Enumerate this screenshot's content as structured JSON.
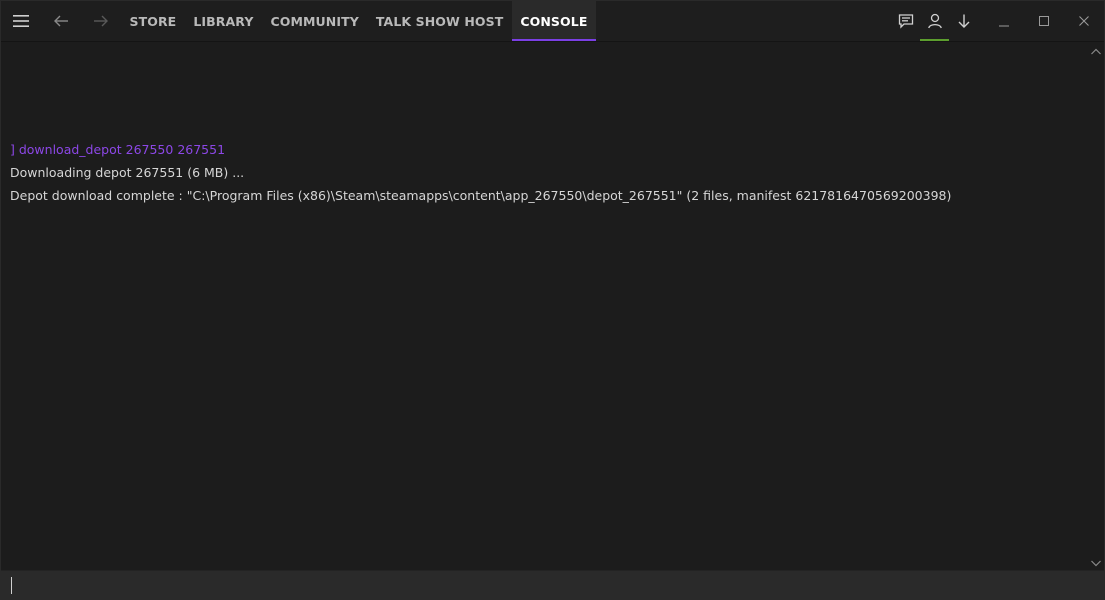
{
  "nav": {
    "menu_icon": "hamburger-icon",
    "back_icon": "arrow-left-icon",
    "forward_icon": "arrow-right-icon",
    "tabs": [
      {
        "label": "STORE",
        "active": false
      },
      {
        "label": "LIBRARY",
        "active": false
      },
      {
        "label": "COMMUNITY",
        "active": false
      },
      {
        "label": "TALK SHOW HOST",
        "active": false
      },
      {
        "label": "CONSOLE",
        "active": true
      }
    ]
  },
  "controls": {
    "icons": [
      "chat-icon",
      "user-icon",
      "download-icon",
      "minimize-icon",
      "maximize-icon",
      "close-icon"
    ],
    "accent_tab": "#7b3fe4",
    "accent_user": "#5c9e2e"
  },
  "console": {
    "command": "] download_depot 267550 267551",
    "output": [
      "Downloading depot 267551 (6 MB) ...",
      "Depot download complete : \"C:\\Program Files (x86)\\Steam\\steamapps\\content\\app_267550\\depot_267551\" (2 files, manifest 6217816470569200398)"
    ],
    "command_color": "#8c47e6"
  },
  "input": {
    "value": ""
  }
}
